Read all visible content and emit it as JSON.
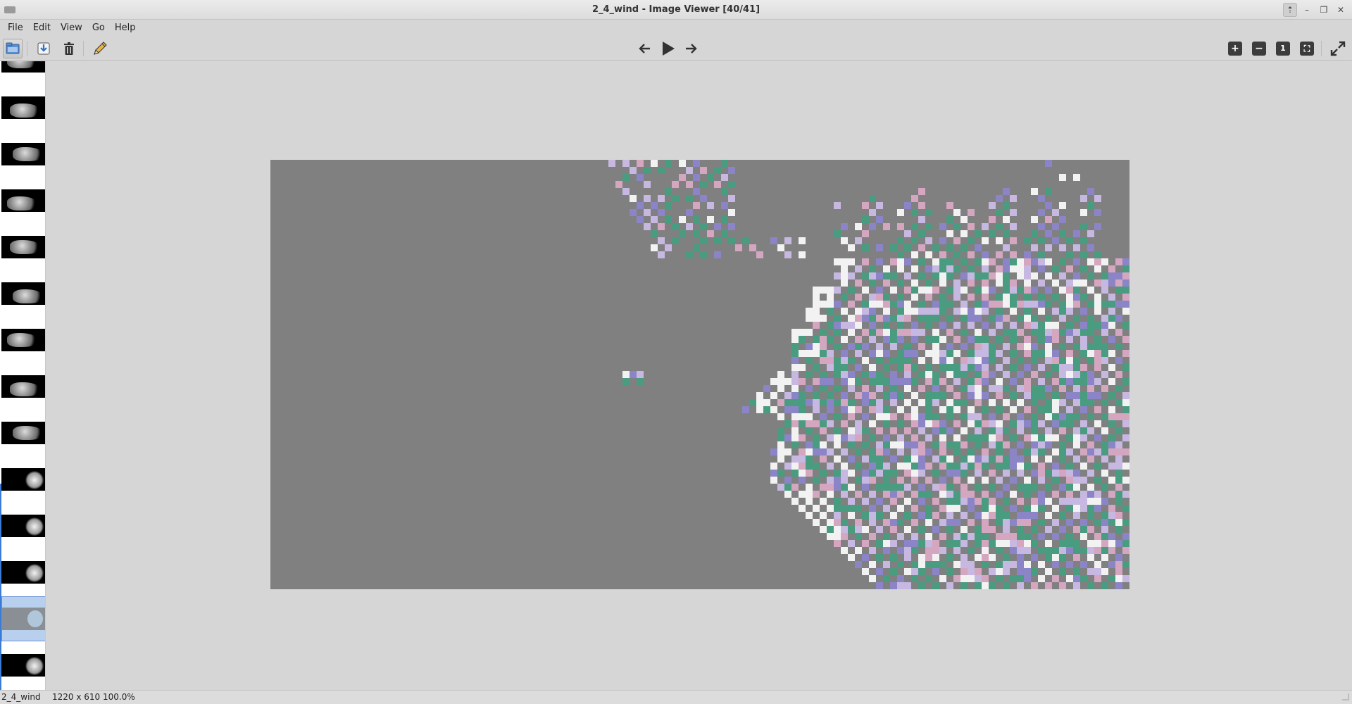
{
  "window": {
    "title": "2_4_wind - Image Viewer [40/41]",
    "controls": [
      "up-icon",
      "minimize-icon",
      "restore-icon",
      "close-icon"
    ]
  },
  "menu": [
    "File",
    "Edit",
    "View",
    "Go",
    "Help"
  ],
  "toolbar": {
    "left": [
      "open-folder-icon",
      "save-icon",
      "delete-icon",
      "edit-pencil-icon"
    ],
    "center": [
      "previous-arrow-icon",
      "play-icon",
      "next-arrow-icon"
    ],
    "right": [
      {
        "icon": "zoom-in-icon",
        "glyph": "+"
      },
      {
        "icon": "zoom-out-icon",
        "glyph": "−"
      },
      {
        "icon": "zoom-original-icon",
        "glyph": "1"
      },
      {
        "icon": "zoom-fit-icon",
        "glyph": "⛶"
      },
      {
        "icon": "fullscreen-icon",
        "glyph": "⤢"
      }
    ]
  },
  "thumbnails": {
    "count": 14,
    "selected_index": 12
  },
  "status": {
    "filename": "2_4_wind",
    "dimensions": "1220 x 610",
    "zoom": "100.0%"
  },
  "colors": {
    "canvas_bg": "#808080",
    "teal": "#4a9c80",
    "purple": "#8b85c7",
    "white": "#f2f2f2",
    "pink": "#d4a6c0",
    "lilac": "#c6b8e0"
  }
}
